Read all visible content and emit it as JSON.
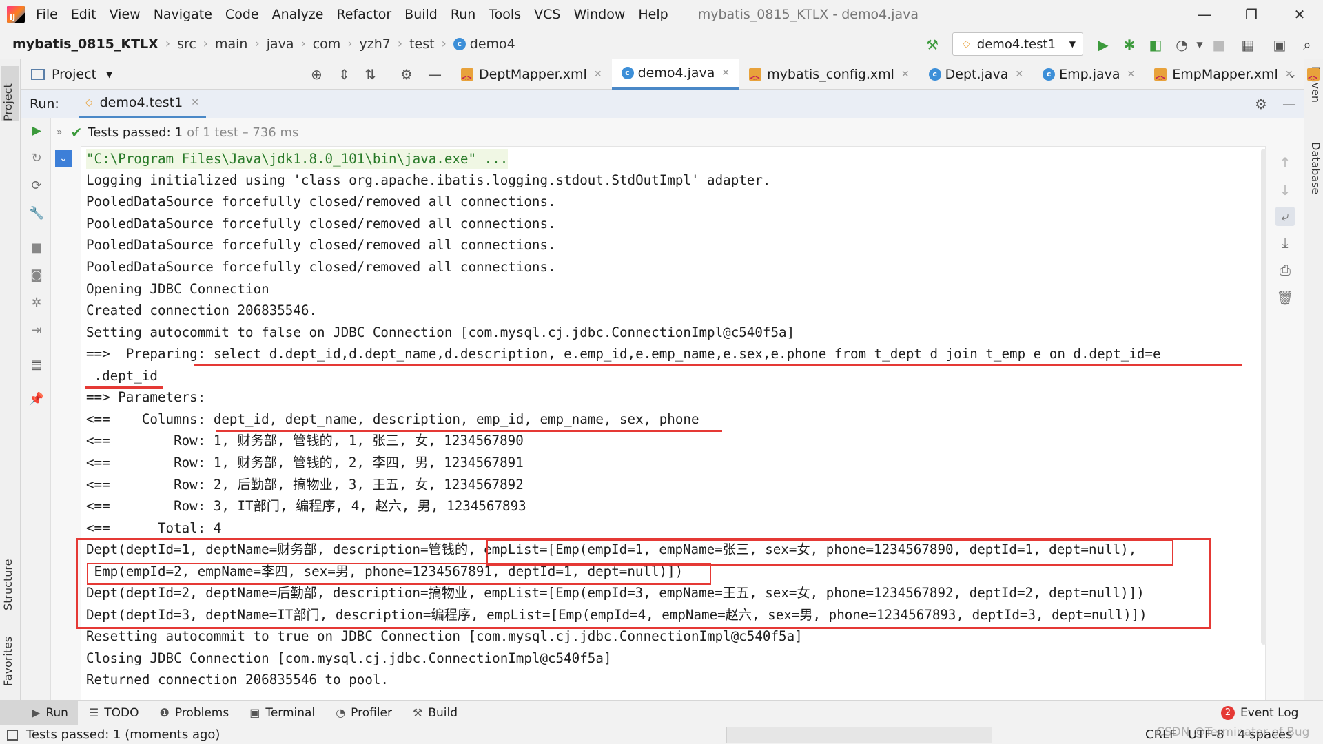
{
  "app": {
    "logo_text": "IJ",
    "window_title": "mybatis_0815_KTLX - demo4.java",
    "menu": [
      "File",
      "Edit",
      "View",
      "Navigate",
      "Code",
      "Analyze",
      "Refactor",
      "Build",
      "Run",
      "Tools",
      "VCS",
      "Window",
      "Help"
    ]
  },
  "breadcrumb": [
    "mybatis_0815_KTLX",
    "src",
    "main",
    "java",
    "com",
    "yzh7",
    "test",
    "demo4"
  ],
  "run_config": "demo4.test1",
  "project_panel": {
    "label": "Project"
  },
  "editor_tabs": [
    {
      "label": "DeptMapper.xml",
      "icon": "xml-file-icon",
      "active": false
    },
    {
      "label": "demo4.java",
      "icon": "class-icon",
      "active": true
    },
    {
      "label": "mybatis_config.xml",
      "icon": "xml-file-icon",
      "active": false
    },
    {
      "label": "Dept.java",
      "icon": "class-icon",
      "active": false
    },
    {
      "label": "Emp.java",
      "icon": "class-icon",
      "active": false
    },
    {
      "label": "EmpMapper.xml",
      "icon": "xml-file-icon",
      "active": false
    }
  ],
  "run_panel": {
    "label": "Run:",
    "tab": "demo4.test1",
    "tests_passed_prefix": "Tests passed:",
    "tests_passed_count": "1",
    "tests_passed_suffix": "of 1 test – 736 ms"
  },
  "console_lines": [
    "\"C:\\Program Files\\Java\\jdk1.8.0_101\\bin\\java.exe\" ...",
    "Logging initialized using 'class org.apache.ibatis.logging.stdout.StdOutImpl' adapter.",
    "PooledDataSource forcefully closed/removed all connections.",
    "PooledDataSource forcefully closed/removed all connections.",
    "PooledDataSource forcefully closed/removed all connections.",
    "PooledDataSource forcefully closed/removed all connections.",
    "Opening JDBC Connection",
    "Created connection 206835546.",
    "Setting autocommit to false on JDBC Connection [com.mysql.cj.jdbc.ConnectionImpl@c540f5a]",
    "==>  Preparing: select d.dept_id,d.dept_name,d.description, e.emp_id,e.emp_name,e.sex,e.phone from t_dept d join t_emp e on d.dept_id=e",
    " .dept_id",
    "==> Parameters: ",
    "<==    Columns: dept_id, dept_name, description, emp_id, emp_name, sex, phone",
    "<==        Row: 1, 财务部, 管钱的, 1, 张三, 女, 1234567890",
    "<==        Row: 1, 财务部, 管钱的, 2, 李四, 男, 1234567891",
    "<==        Row: 2, 后勤部, 搞物业, 3, 王五, 女, 1234567892",
    "<==        Row: 3, IT部门, 编程序, 4, 赵六, 男, 1234567893",
    "<==      Total: 4",
    "Dept(deptId=1, deptName=财务部, description=管钱的, empList=[Emp(empId=1, empName=张三, sex=女, phone=1234567890, deptId=1, dept=null),",
    " Emp(empId=2, empName=李四, sex=男, phone=1234567891, deptId=1, dept=null)])",
    "Dept(deptId=2, deptName=后勤部, description=搞物业, empList=[Emp(empId=3, empName=王五, sex=女, phone=1234567892, deptId=2, dept=null)])",
    "Dept(deptId=3, deptName=IT部门, description=编程序, empList=[Emp(empId=4, empName=赵六, sex=男, phone=1234567893, deptId=3, dept=null)])",
    "Resetting autocommit to true on JDBC Connection [com.mysql.cj.jdbc.ConnectionImpl@c540f5a]",
    "Closing JDBC Connection [com.mysql.cj.jdbc.ConnectionImpl@c540f5a]",
    "Returned connection 206835546 to pool."
  ],
  "side_labels": {
    "project": "Project",
    "structure": "Structure",
    "favorites": "Favorites",
    "maven": "Maven",
    "database": "Database"
  },
  "bottom_tabs": [
    {
      "label": "Run",
      "icon": "play-icon"
    },
    {
      "label": "TODO",
      "icon": "list-icon"
    },
    {
      "label": "Problems",
      "icon": "info-icon"
    },
    {
      "label": "Terminal",
      "icon": "terminal-icon"
    },
    {
      "label": "Profiler",
      "icon": "profiler-icon"
    },
    {
      "label": "Build",
      "icon": "hammer-icon"
    }
  ],
  "event_log": {
    "label": "Event Log",
    "count": "2"
  },
  "status_bar": {
    "message": "Tests passed: 1 (moments ago)",
    "line_sep": "CRLF",
    "encoding": "UTF-8",
    "indent": "4 spaces",
    "watermark": "CSDN @Terminator of Bug"
  },
  "colors": {
    "accent": "#4a88c7",
    "run_green": "#3c9a3c",
    "annotation_red": "#e53935",
    "console_green": "#287a28"
  }
}
